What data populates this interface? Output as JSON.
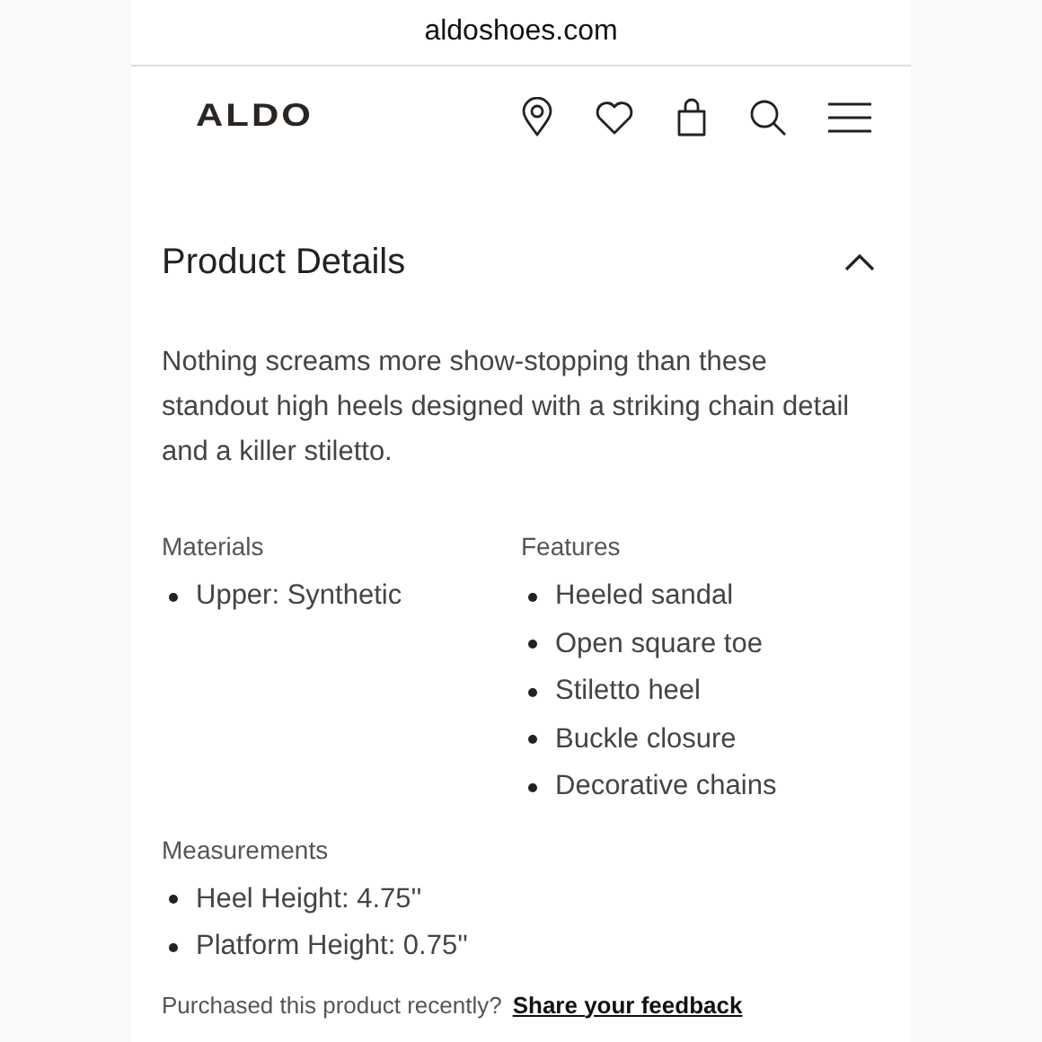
{
  "address_bar": {
    "url": "aldoshoes.com"
  },
  "header": {
    "logo": "ALDO"
  },
  "section": {
    "title": "Product Details",
    "expanded": true,
    "description": "Nothing screams more show-stopping than these standout high heels designed with a striking chain detail and a killer stiletto.",
    "groups": [
      {
        "title": "Materials",
        "items": [
          "Upper: Synthetic"
        ]
      },
      {
        "title": "Features",
        "items": [
          "Heeled sandal",
          "Open square toe",
          "Stiletto heel",
          "Buckle closure",
          "Decorative chains"
        ]
      },
      {
        "title": "Measurements",
        "items": [
          "Heel Height: 4.75''",
          "Platform Height: 0.75''"
        ]
      }
    ],
    "feedback": {
      "prompt": "Purchased this product recently?",
      "link": "Share your feedback"
    }
  }
}
